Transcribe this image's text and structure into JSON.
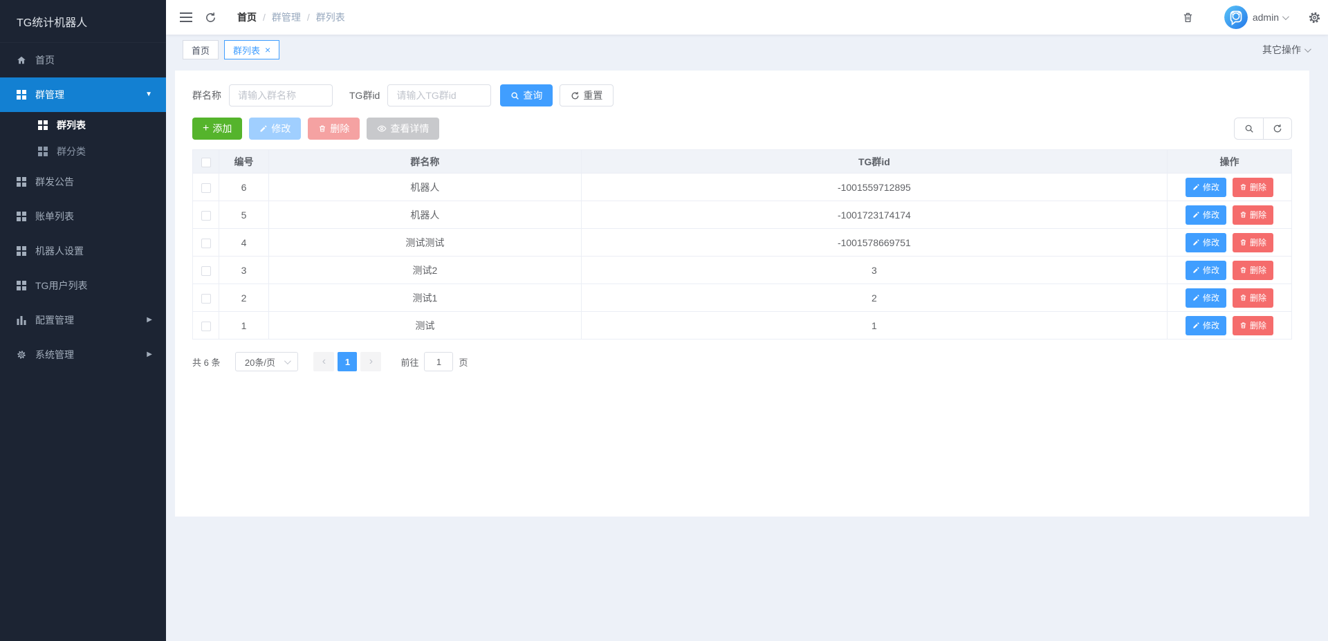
{
  "app": {
    "title": "TG统计机器人"
  },
  "sidebar": {
    "items": [
      {
        "label": "首页"
      },
      {
        "label": "群管理"
      },
      {
        "label": "群发公告"
      },
      {
        "label": "账单列表"
      },
      {
        "label": "机器人设置"
      },
      {
        "label": "TG用户列表"
      },
      {
        "label": "配置管理"
      },
      {
        "label": "系统管理"
      }
    ],
    "submenu": [
      {
        "label": "群列表"
      },
      {
        "label": "群分类"
      }
    ]
  },
  "navbar": {
    "breadcrumb": {
      "home": "首页",
      "section": "群管理",
      "current": "群列表",
      "separator": "/"
    },
    "username": "admin"
  },
  "tagbar": {
    "tags": [
      {
        "label": "首页"
      },
      {
        "label": "群列表",
        "close": "×"
      }
    ],
    "more_label": "其它操作"
  },
  "filters": {
    "name_label": "群名称",
    "name_placeholder": "请输入群名称",
    "id_label": "TG群id",
    "id_placeholder": "请输入TG群id",
    "search_label": "查询",
    "reset_label": "重置"
  },
  "toolbar": {
    "add_icon": "+",
    "add_label": "添加",
    "edit_label": "修改",
    "delete_label": "删除",
    "detail_label": "查看详情"
  },
  "table": {
    "columns": {
      "id": "编号",
      "name": "群名称",
      "tgid": "TG群id",
      "ops": "操作"
    },
    "rows": [
      {
        "id": "6",
        "name": "机器人",
        "tgid": "-1001559712895"
      },
      {
        "id": "5",
        "name": "机器人",
        "tgid": "-1001723174174"
      },
      {
        "id": "4",
        "name": "测试测试",
        "tgid": "-1001578669751"
      },
      {
        "id": "3",
        "name": "测试2",
        "tgid": "3"
      },
      {
        "id": "2",
        "name": "测试1",
        "tgid": "2"
      },
      {
        "id": "1",
        "name": "测试",
        "tgid": "1"
      }
    ],
    "edit_label": "修改",
    "delete_label": "删除"
  },
  "pagination": {
    "total_label": "共 6 条",
    "page_size_label": "20条/页",
    "prev_icon": "‹",
    "next_icon": "›",
    "current_page": "1",
    "goto_label": "前往",
    "goto_value": "1",
    "page_unit_label": "页"
  },
  "colors": {
    "sidebar_bg": "#1c2433",
    "sidebar_active_bg": "#1380d2",
    "primary": "#409eff",
    "success": "#55b42c",
    "danger": "#f56c6c",
    "disabled_primary": "#a0cfff",
    "disabled_danger": "#f5a2a2",
    "disabled_info": "#c8c9cc",
    "page_bg": "#edf1f8"
  }
}
